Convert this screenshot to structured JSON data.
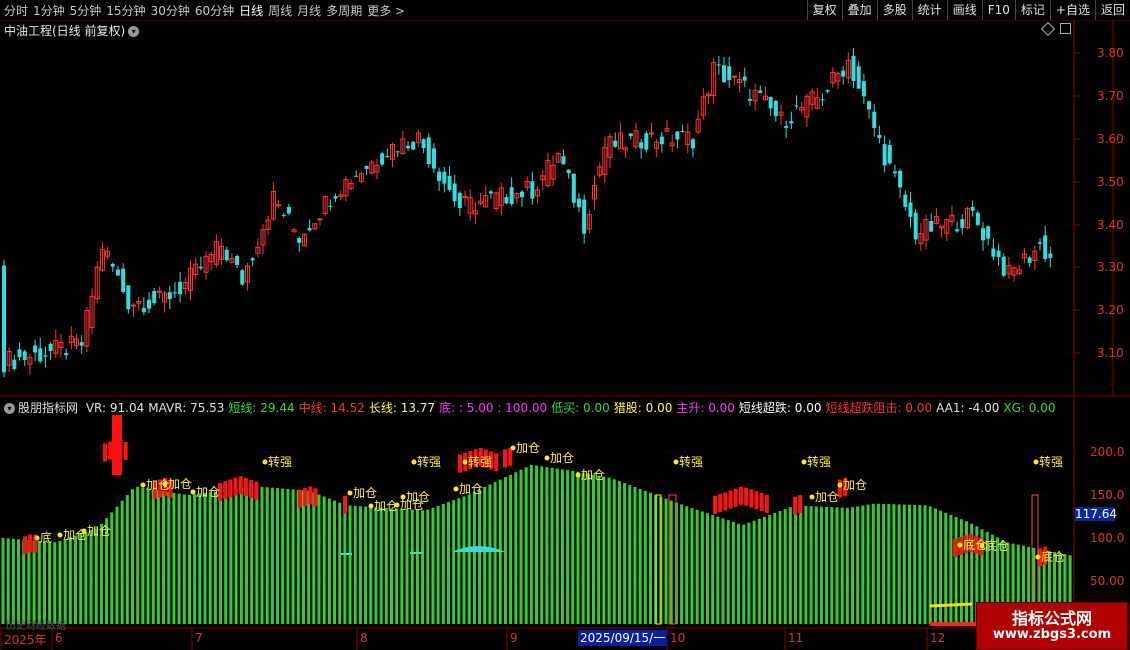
{
  "toolbar": {
    "periods": [
      "分时",
      "1分钟",
      "5分钟",
      "15分钟",
      "30分钟",
      "60分钟",
      "日线",
      "周线",
      "月线",
      "多周期",
      "更多 >"
    ],
    "active_period": "日线",
    "right_buttons": [
      "复权",
      "叠加",
      "多股",
      "统计",
      "画线",
      "F10",
      "+自选",
      "返回"
    ],
    "right_extra": "标记"
  },
  "main_chart": {
    "title": "中油工程(日线 前复权)",
    "y_ticks": [
      "3.80",
      "3.70",
      "3.60",
      "3.50",
      "3.40",
      "3.30",
      "3.20",
      "3.10"
    ]
  },
  "indicator": {
    "name": "股朋指标网",
    "fields": [
      {
        "label": "VR: 91.04",
        "color": "#e0e0e0"
      },
      {
        "label": "MAVR: 75.53",
        "color": "#e0e0e0"
      },
      {
        "label": "短线: 29.44",
        "color": "#33dd33"
      },
      {
        "label": "中线: 14.52",
        "color": "#ff3333"
      },
      {
        "label": "长线: 13.77",
        "color": "#ffff33"
      },
      {
        "label": "底: : 5.00 : 100.00",
        "color": "#ff33ff"
      },
      {
        "label": "低买: 0.00",
        "color": "#33dd33"
      },
      {
        "label": "猎股: 0.00",
        "color": "#ffff33"
      },
      {
        "label": "主升: 0.00",
        "color": "#ff33ff"
      },
      {
        "label": "短线超跌: 0.00",
        "color": "#ffffff"
      },
      {
        "label": "短线超跌阻击: 0.00",
        "color": "#ff3333"
      },
      {
        "label": "AA1: -4.00",
        "color": "#e0e0e0"
      },
      {
        "label": "XG: 0.00",
        "color": "#33dd33"
      }
    ],
    "y_ticks": [
      "200.0",
      "150.0",
      "100.0",
      "50.00"
    ],
    "current_value": "117.64",
    "signals": {
      "di": "底",
      "jiacang": "加仓",
      "zhuanqiang": "转强",
      "dicang": "底仓"
    },
    "footer_text": "历史财经数据"
  },
  "dates": {
    "labels": [
      "2025年",
      "6",
      "7",
      "8",
      "9",
      "10",
      "11",
      "12"
    ],
    "selected": "2025/09/15/一"
  },
  "watermark": {
    "line1": "指标公式网",
    "line2": "www.zbgs3.com"
  },
  "colors": {
    "up": "#ff3333",
    "down": "#33dddd",
    "green_bar": "#33cc33",
    "red_bar": "#ff1111",
    "grid": "#5a0000",
    "axis": "#8a0000"
  }
}
